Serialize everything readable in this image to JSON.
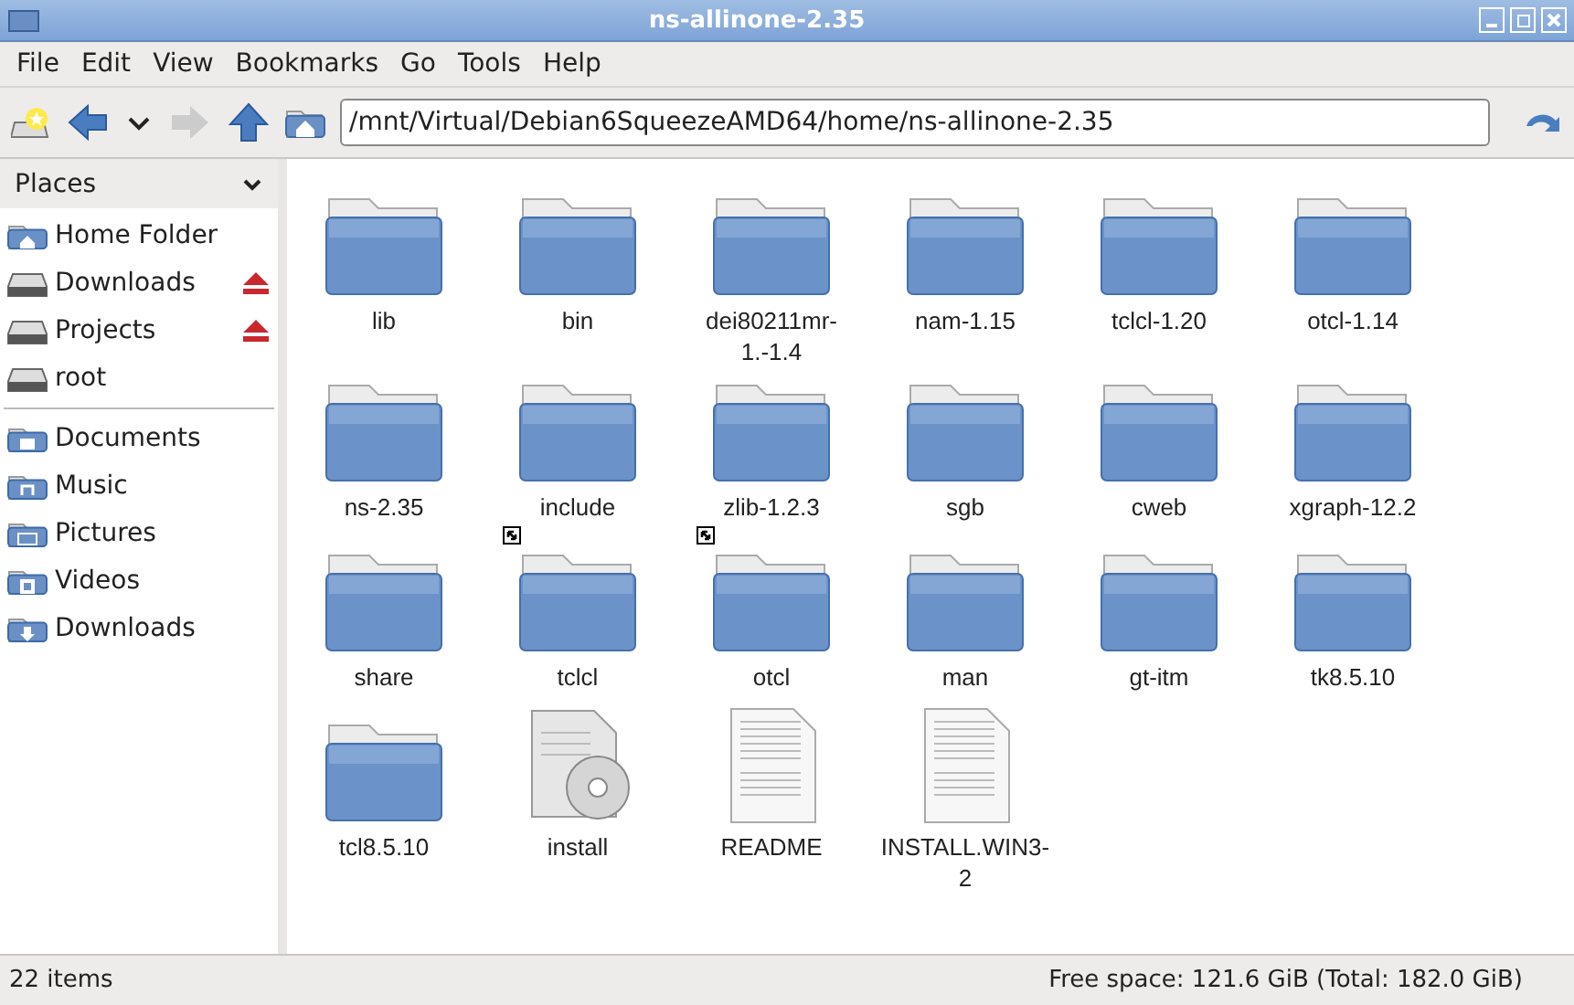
{
  "window": {
    "title": "ns-allinone-2.35"
  },
  "menu": [
    "File",
    "Edit",
    "View",
    "Bookmarks",
    "Go",
    "Tools",
    "Help"
  ],
  "location": {
    "value": "/mnt/Virtual/Debian6SqueezeAMD64/home/ns-allinone-2.35"
  },
  "sidebar": {
    "title": "Places",
    "groups": [
      [
        {
          "label": "Home Folder",
          "kind": "home",
          "ejectable": false
        },
        {
          "label": "Downloads",
          "kind": "drive",
          "ejectable": true
        },
        {
          "label": "Projects",
          "kind": "drive",
          "ejectable": true
        },
        {
          "label": "root",
          "kind": "drive",
          "ejectable": false
        }
      ],
      [
        {
          "label": "Documents",
          "kind": "documents",
          "ejectable": false
        },
        {
          "label": "Music",
          "kind": "music",
          "ejectable": false
        },
        {
          "label": "Pictures",
          "kind": "pictures",
          "ejectable": false
        },
        {
          "label": "Videos",
          "kind": "videos",
          "ejectable": false
        },
        {
          "label": "Downloads",
          "kind": "downloads",
          "ejectable": false
        }
      ]
    ]
  },
  "files": [
    {
      "name": "lib",
      "kind": "folder",
      "link": false
    },
    {
      "name": "bin",
      "kind": "folder",
      "link": false
    },
    {
      "name": "dei80211mr-1.-1.4",
      "kind": "folder",
      "link": false
    },
    {
      "name": "nam-1.15",
      "kind": "folder",
      "link": false
    },
    {
      "name": "tclcl-1.20",
      "kind": "folder",
      "link": false
    },
    {
      "name": "otcl-1.14",
      "kind": "folder",
      "link": false
    },
    {
      "name": "ns-2.35",
      "kind": "folder",
      "link": false
    },
    {
      "name": "include",
      "kind": "folder",
      "link": false
    },
    {
      "name": "zlib-1.2.3",
      "kind": "folder",
      "link": false
    },
    {
      "name": "sgb",
      "kind": "folder",
      "link": false
    },
    {
      "name": "cweb",
      "kind": "folder",
      "link": false
    },
    {
      "name": "xgraph-12.2",
      "kind": "folder",
      "link": false
    },
    {
      "name": "share",
      "kind": "folder",
      "link": false
    },
    {
      "name": "tclcl",
      "kind": "folder",
      "link": true
    },
    {
      "name": "otcl",
      "kind": "folder",
      "link": true
    },
    {
      "name": "man",
      "kind": "folder",
      "link": false
    },
    {
      "name": "gt-itm",
      "kind": "folder",
      "link": false
    },
    {
      "name": "tk8.5.10",
      "kind": "folder",
      "link": false
    },
    {
      "name": "tcl8.5.10",
      "kind": "folder",
      "link": false
    },
    {
      "name": "install",
      "kind": "installer",
      "link": false
    },
    {
      "name": "README",
      "kind": "text",
      "link": false
    },
    {
      "name": "INSTALL.WIN3-2",
      "kind": "text",
      "link": false
    }
  ],
  "status_bar": {
    "count": "22 items",
    "free_space": "Free space: 121.6 GiB (Total: 182.0 GiB)"
  }
}
